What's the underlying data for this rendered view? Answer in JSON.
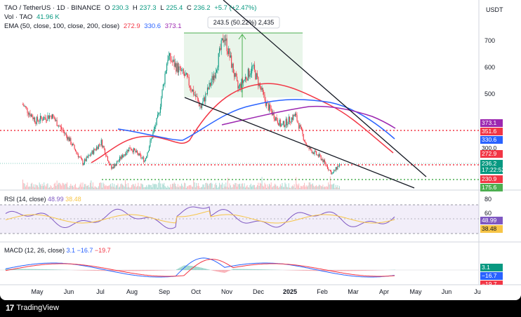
{
  "header": {
    "pair": "TAO / TetherUS · 1D · BINANCE",
    "o_label": "O",
    "o": "230.3",
    "h_label": "H",
    "h": "237.3",
    "l_label": "L",
    "l": "225.4",
    "c_label": "C",
    "c": "236.2",
    "change": "+5.7 (+2.47%)",
    "vol_label": "Vol · TAO",
    "vol": "41.96 K",
    "ema_label": "EMA (50, close, 100, close, 200, close)",
    "ema50": "272.9",
    "ema100": "330.6",
    "ema200": "373.1",
    "currency": "USDT"
  },
  "measure": {
    "text": "243.5 (50.22%) 2,435"
  },
  "rsi": {
    "label": "RSI (14, close)",
    "value": "48.99",
    "ma": "38.48"
  },
  "macd": {
    "label": "MACD (12, 26, close)",
    "macd": "3.1",
    "signal": "−16.7",
    "hist": "−19.7"
  },
  "footer": {
    "brand": "TradingView"
  },
  "colors": {
    "up": "#089981",
    "down": "#f23645",
    "ema50": "#f23645",
    "ema100": "#2962ff",
    "ema200": "#9c27b0",
    "rsi": "#7e57c2",
    "rsi_ma": "#f7c547",
    "dotted_red": "#f23645",
    "dotted_green": "#4caf50"
  },
  "chart_data": {
    "type": "candlestick",
    "x_ticks": [
      "May",
      "Jun",
      "Jul",
      "Aug",
      "Sep",
      "Oct",
      "Nov",
      "Dec",
      "2025",
      "Feb",
      "Mar",
      "Apr",
      "May",
      "Jun",
      "Ju"
    ],
    "price_axis": {
      "ticks": [
        700.0,
        600.0,
        500.0
      ],
      "range": [
        160,
        800
      ]
    },
    "price_labels": [
      {
        "value": "373.1",
        "color": "#9c27b0"
      },
      {
        "value": "351.6",
        "color": "#f23645"
      },
      {
        "value": "330.6",
        "color": "#2962ff"
      },
      {
        "value": "300.0",
        "color": null
      },
      {
        "value": "272.9",
        "color": "#f23645"
      },
      {
        "value": "236.2",
        "color": "#089981",
        "countdown": "17:22:52"
      },
      {
        "value": "230.9",
        "color": "#f23645"
      },
      {
        "value": "175.6",
        "color": "#4caf50"
      }
    ],
    "horizontal_levels": [
      {
        "value": 351.6,
        "style": "dotted",
        "color": "#f23645"
      },
      {
        "value": 230.9,
        "style": "dotted",
        "color": "#f23645"
      },
      {
        "value": 175.6,
        "style": "dotted",
        "color": "#4caf50"
      }
    ],
    "measure_box": {
      "from": 485,
      "to": 728.5,
      "change": "243.5 (50.22%)",
      "bars": "2,435"
    },
    "price_series": [
      {
        "date": "2024-05-01",
        "close": 460
      },
      {
        "date": "2024-05-15",
        "close": 400
      },
      {
        "date": "2024-06-01",
        "close": 420
      },
      {
        "date": "2024-06-20",
        "close": 330
      },
      {
        "date": "2024-07-05",
        "close": 240
      },
      {
        "date": "2024-07-25",
        "close": 320
      },
      {
        "date": "2024-08-05",
        "close": 220
      },
      {
        "date": "2024-08-25",
        "close": 300
      },
      {
        "date": "2024-09-10",
        "close": 250
      },
      {
        "date": "2024-09-25",
        "close": 420
      },
      {
        "date": "2024-10-05",
        "close": 640
      },
      {
        "date": "2024-10-25",
        "close": 560
      },
      {
        "date": "2024-11-10",
        "close": 450
      },
      {
        "date": "2024-11-25",
        "close": 580
      },
      {
        "date": "2024-12-05",
        "close": 720
      },
      {
        "date": "2024-12-20",
        "close": 520
      },
      {
        "date": "2025-01-05",
        "close": 600
      },
      {
        "date": "2025-01-20",
        "close": 460
      },
      {
        "date": "2025-02-05",
        "close": 380
      },
      {
        "date": "2025-02-20",
        "close": 420
      },
      {
        "date": "2025-03-05",
        "close": 300
      },
      {
        "date": "2025-03-20",
        "close": 260
      },
      {
        "date": "2025-04-01",
        "close": 200
      },
      {
        "date": "2025-04-09",
        "close": 236.2
      }
    ],
    "rsi_axis": {
      "ticks": [
        80.0,
        60.0
      ],
      "range": [
        20,
        90
      ]
    }
  }
}
